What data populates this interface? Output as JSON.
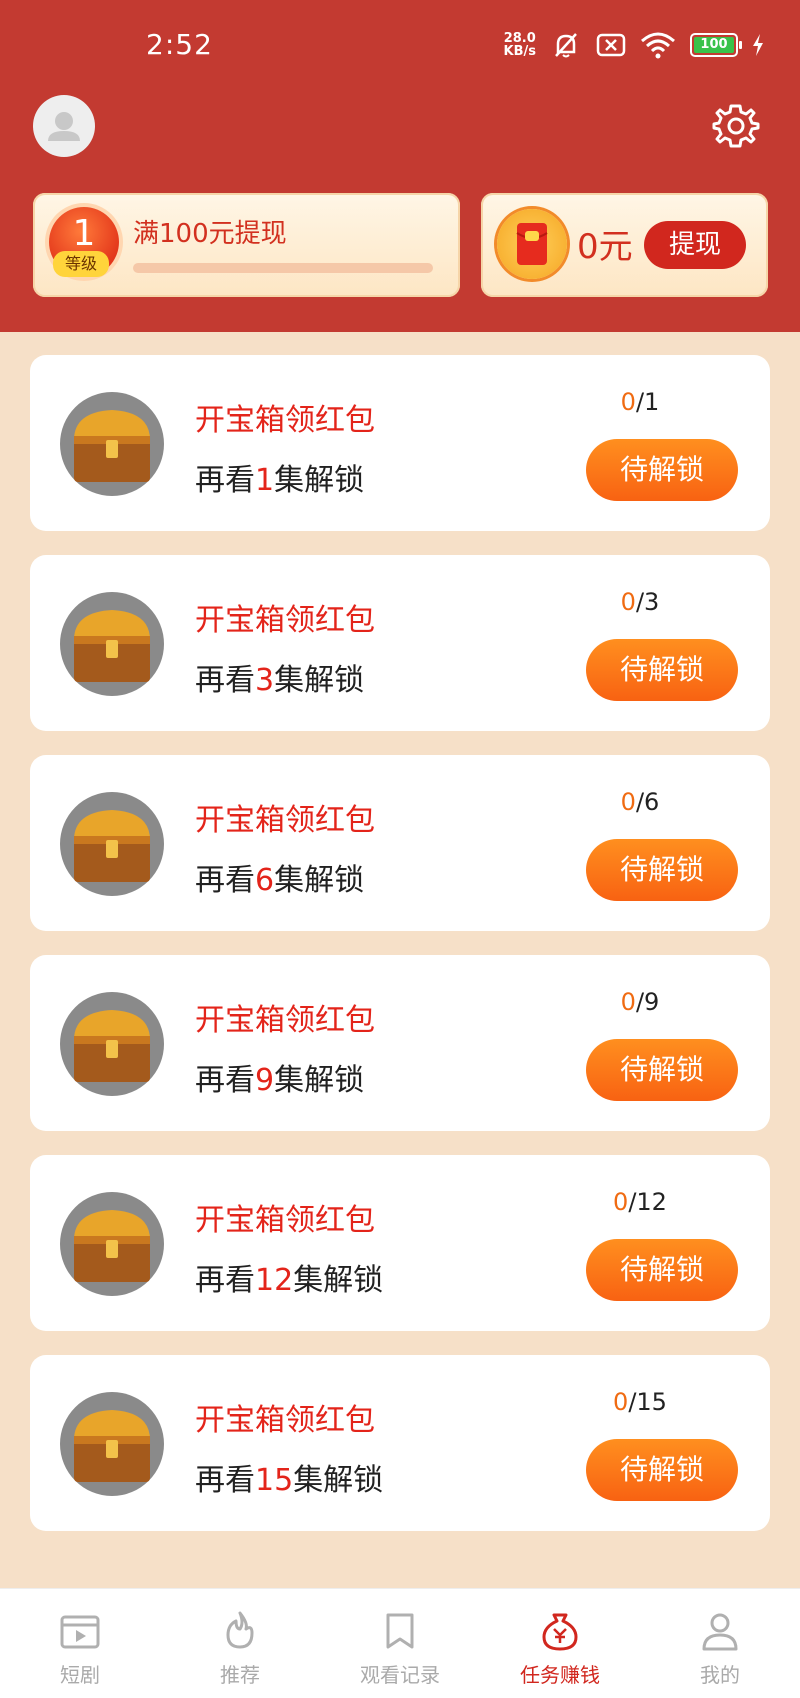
{
  "status_bar": {
    "time": "2:52",
    "net_speed_value": "28.0",
    "net_speed_unit": "KB/s",
    "battery": "100"
  },
  "header": {
    "level": {
      "number": "1",
      "tag": "等级",
      "text": "满100元提现",
      "progress": 0
    },
    "wallet": {
      "amount": "0元",
      "withdraw_label": "提现"
    }
  },
  "tasks": [
    {
      "title": "开宝箱领红包",
      "sub_prefix": "再看",
      "count": "1",
      "sub_suffix": "集解锁",
      "done": "0",
      "total": "/1",
      "button": "待解锁"
    },
    {
      "title": "开宝箱领红包",
      "sub_prefix": "再看",
      "count": "3",
      "sub_suffix": "集解锁",
      "done": "0",
      "total": "/3",
      "button": "待解锁"
    },
    {
      "title": "开宝箱领红包",
      "sub_prefix": "再看",
      "count": "6",
      "sub_suffix": "集解锁",
      "done": "0",
      "total": "/6",
      "button": "待解锁"
    },
    {
      "title": "开宝箱领红包",
      "sub_prefix": "再看",
      "count": "9",
      "sub_suffix": "集解锁",
      "done": "0",
      "total": "/9",
      "button": "待解锁"
    },
    {
      "title": "开宝箱领红包",
      "sub_prefix": "再看",
      "count": "12",
      "sub_suffix": "集解锁",
      "done": "0",
      "total": "/12",
      "button": "待解锁"
    },
    {
      "title": "开宝箱领红包",
      "sub_prefix": "再看",
      "count": "15",
      "sub_suffix": "集解锁",
      "done": "0",
      "total": "/15",
      "button": "待解锁"
    }
  ],
  "tab_bar": {
    "items": [
      {
        "label": "短剧",
        "icon": "film-icon"
      },
      {
        "label": "推荐",
        "icon": "flame-icon"
      },
      {
        "label": "观看记录",
        "icon": "bookmark-icon"
      },
      {
        "label": "任务赚钱",
        "icon": "money-bag-icon",
        "active": true
      },
      {
        "label": "我的",
        "icon": "person-icon"
      }
    ]
  },
  "colors": {
    "header_red": "#c33a31",
    "accent_red": "#e3241a",
    "button_orange": "#f86212",
    "page_bg": "#f6e0c8"
  }
}
